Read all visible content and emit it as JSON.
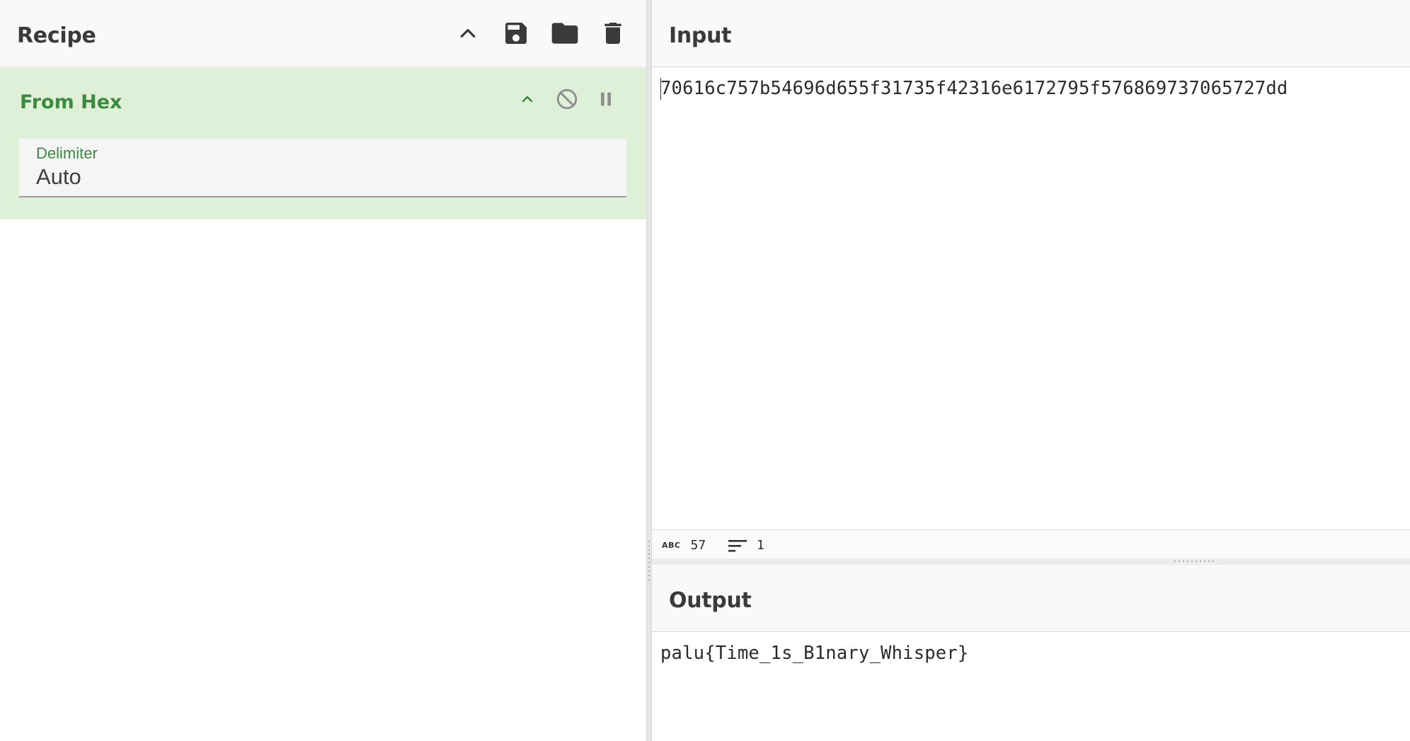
{
  "recipe": {
    "title": "Recipe",
    "icons": [
      "chevron-up-icon",
      "save-icon",
      "folder-icon",
      "trash-icon"
    ]
  },
  "operation": {
    "name": "From Hex",
    "icons": [
      "chevron-up-icon",
      "disable-icon",
      "pause-icon"
    ],
    "delimiter_label": "Delimiter",
    "delimiter_value": "Auto"
  },
  "input": {
    "title": "Input",
    "text": "70616c757b54696d655f31735f42316e6172795f576869737065727dd",
    "char_count": "57",
    "line_count": "1"
  },
  "output": {
    "title": "Output",
    "text": "palu{Time_1s_B1nary_Whisper}"
  },
  "colors": {
    "op_background": "#dff0d8",
    "op_title": "#3c8a3d",
    "header_background": "#f9f9f9",
    "icon_dark": "#3a3a3a"
  }
}
